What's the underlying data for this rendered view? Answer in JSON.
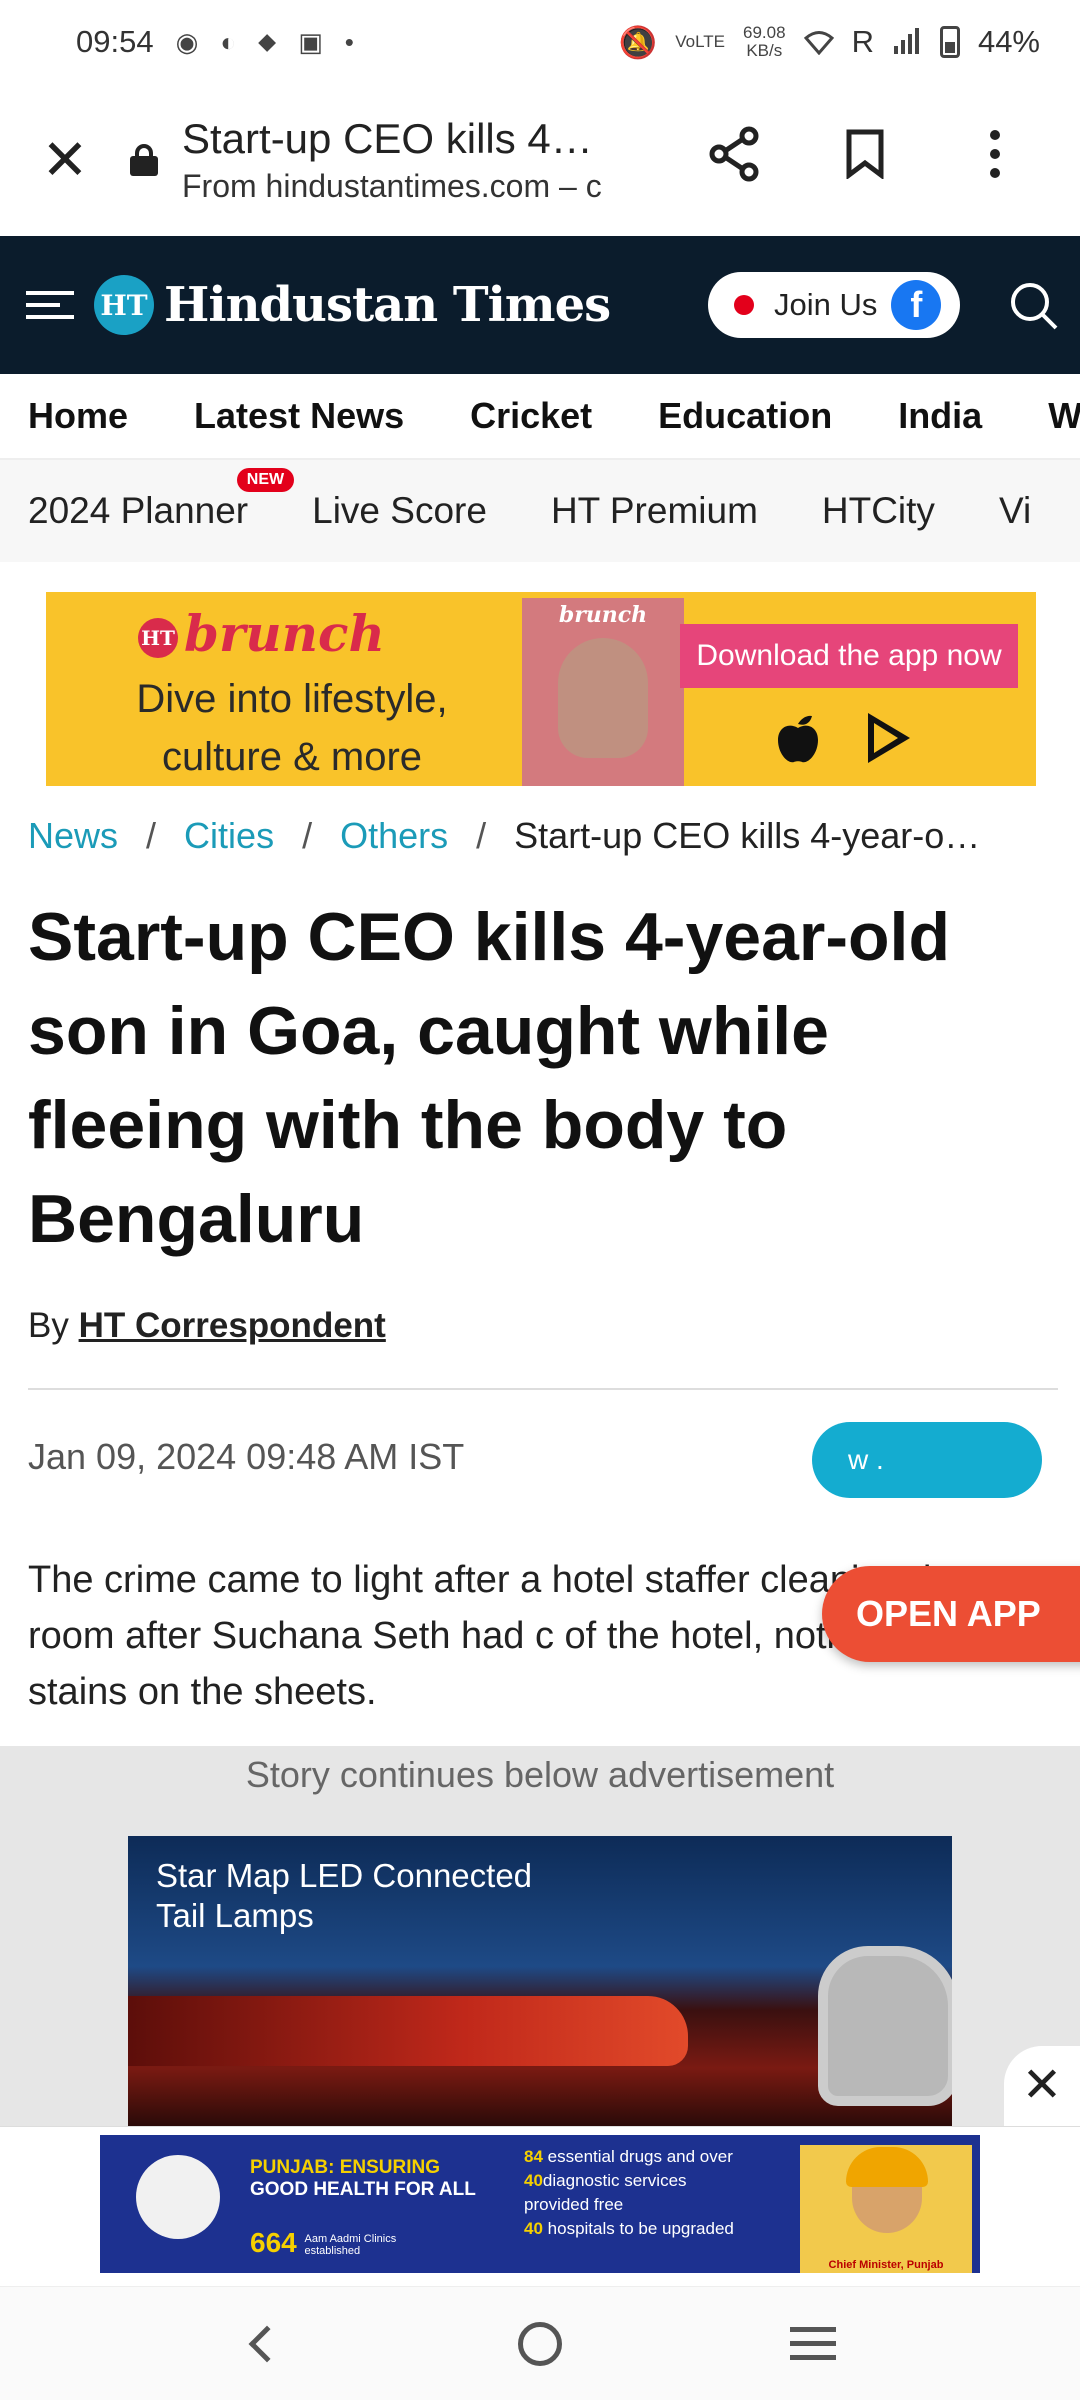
{
  "status_bar": {
    "time": "09:54",
    "net_speed_value": "69.08",
    "net_speed_unit": "KB/s",
    "volte": "VoLTE",
    "roaming": "R",
    "battery": "44%"
  },
  "tab_bar": {
    "title": "Start-up CEO kills 4…",
    "url": "From hindustantimes.com – c"
  },
  "header": {
    "logo_badge": "HT",
    "logo_text": "Hindustan Times",
    "join_label": "Join Us",
    "fb_glyph": "f"
  },
  "nav_main": [
    "Home",
    "Latest News",
    "Cricket",
    "Education",
    "India",
    "W"
  ],
  "nav_sub": {
    "items": [
      "2024 Planner",
      "Live Score",
      "HT Premium",
      "HTCity",
      "Vi"
    ],
    "new_badge": "NEW"
  },
  "banner": {
    "logo": "brunch",
    "logo_badge": "HT",
    "line1": "Dive into lifestyle,",
    "line2": "culture & more",
    "mag_title": "brunch",
    "download": "Download the app now"
  },
  "breadcrumb": {
    "items": [
      "News",
      "Cities",
      "Others"
    ],
    "current": "Start-up CEO kills 4-year-o…",
    "separator": "/"
  },
  "article": {
    "headline": "Start-up CEO kills 4-year-old son in Goa, caught while fleeing with the body to Bengaluru",
    "by_prefix": "By",
    "author": "HT Correspondent",
    "date": "Jan 09, 2024 09:48 AM IST",
    "share_label": "w .",
    "summary": "The crime came to light after a hotel staffer cleaning the room after Suchana Seth had c of the hotel, noticed blood stains on the sheets.",
    "open_app": "OPEN APP"
  },
  "ad": {
    "caption": "Story continues below advertisement",
    "video_caption_1": "Star Map LED Connected",
    "video_caption_2": "Tail Lamps",
    "close": "✕"
  },
  "sticky_ad": {
    "line1": "PUNJAB: ENSURING",
    "line2": "GOOD HEALTH FOR ALL",
    "stat_num": "664",
    "stat_text_1": "Aam Aadmi Clinics",
    "stat_text_2": "established",
    "r1_num": "84",
    "r1_text": "essential drugs and over",
    "r2_num": "40",
    "r2_text": "diagnostic services",
    "r3_text": "provided free",
    "r4_num": "40",
    "r4_text": "hospitals to be upgraded",
    "name": "Chief Minister, Punjab"
  },
  "colors": {
    "header_bg": "#0b1c2c",
    "accent_link": "#1b9bb8",
    "open_app": "#ec4e34",
    "share_pill": "#14acd0",
    "banner_bg": "#f9c32a"
  }
}
